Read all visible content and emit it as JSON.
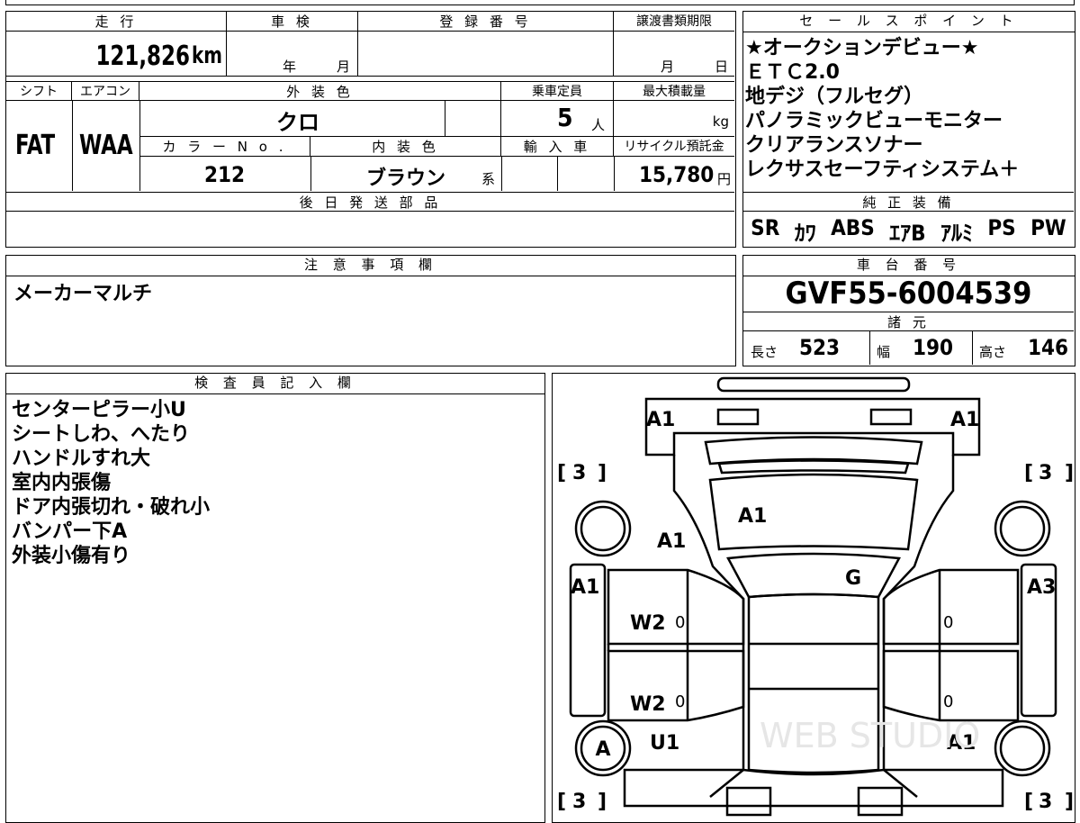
{
  "top_strip": {
    "partial_text": "…"
  },
  "mileage": {
    "label": "走 行",
    "value": "121,826",
    "unit": "km"
  },
  "shaken": {
    "label": "車 検",
    "year_label": "年",
    "month_label": "月"
  },
  "registration_number": {
    "label": "登 録 番 号",
    "value": ""
  },
  "transfer_deadline": {
    "label": "譲渡書類期限",
    "month_label": "月",
    "day_label": "日"
  },
  "shift": {
    "label": "シフト",
    "value": "FAT"
  },
  "aircon": {
    "label": "エアコン",
    "value": "WAA"
  },
  "exterior_color": {
    "label": "外 装 色",
    "value": "クロ"
  },
  "capacity": {
    "label": "乗車定員",
    "value": "5",
    "unit": "人"
  },
  "max_load": {
    "label": "最大積載量",
    "unit": "kg"
  },
  "color_no": {
    "label": "カ ラ ー N o .",
    "value": "212"
  },
  "interior_color": {
    "label": "内 装 色",
    "value": "ブラウン",
    "suffix": "系"
  },
  "import": {
    "label": "輸 入 車"
  },
  "recycle": {
    "label": "リサイクル預託金",
    "value": "15,780",
    "unit": "円"
  },
  "later_parts": {
    "label": "後 日 発 送 部 品",
    "value": ""
  },
  "sales_points": {
    "label": "セ ー ル ス ポ イ ン ト",
    "items": [
      "★オークションデビュー★",
      "ＥＴＣ2.0",
      "地デジ（フルセグ）",
      "パノラミックビューモニター",
      "クリアランスソナー",
      "レクサスセーフティシステム＋"
    ]
  },
  "equipment": {
    "label": "純 正 装 備",
    "items": [
      "SR",
      "ｶﾜ",
      "ABS",
      "ｴｱB",
      "ｱﾙﾐ",
      "PS",
      "PW"
    ]
  },
  "notes": {
    "label": "注 意 事 項 欄",
    "text": "メーカーマルチ"
  },
  "chassis": {
    "label": "車 台 番 号",
    "value": "GVF55-6004539"
  },
  "specs": {
    "label": "諸 元",
    "length_label": "長さ",
    "length": "523",
    "width_label": "幅",
    "width": "190",
    "height_label": "高さ",
    "height": "146"
  },
  "inspector": {
    "label": "検 査 員 記 入 欄",
    "lines": [
      "センターピラー小U",
      "シートしわ、へたり",
      "ハンドルすれ大",
      "室内内張傷",
      "ドア内張切れ・破れ小",
      "バンパー下A",
      "外装小傷有り"
    ]
  },
  "diagram": {
    "marks": {
      "front_left": "A1",
      "front_right": "A1",
      "tire_fl": "3",
      "tire_fr": "3",
      "tire_rl": "3",
      "tire_rr": "3",
      "hood": "A1",
      "fender_left": "A1",
      "roof_g": "G",
      "left_front_side": "A1",
      "right_front_side": "A3",
      "door_left_front": "W2",
      "door_left_rear": "W2",
      "door_zero_lf": "0",
      "door_zero_lr": "0",
      "door_zero_rf": "0",
      "door_zero_rr": "0",
      "wheel_rear_left": "A",
      "rear_left": "U1",
      "rear_right": "A1"
    },
    "watermark": "WEB STUDIO"
  }
}
